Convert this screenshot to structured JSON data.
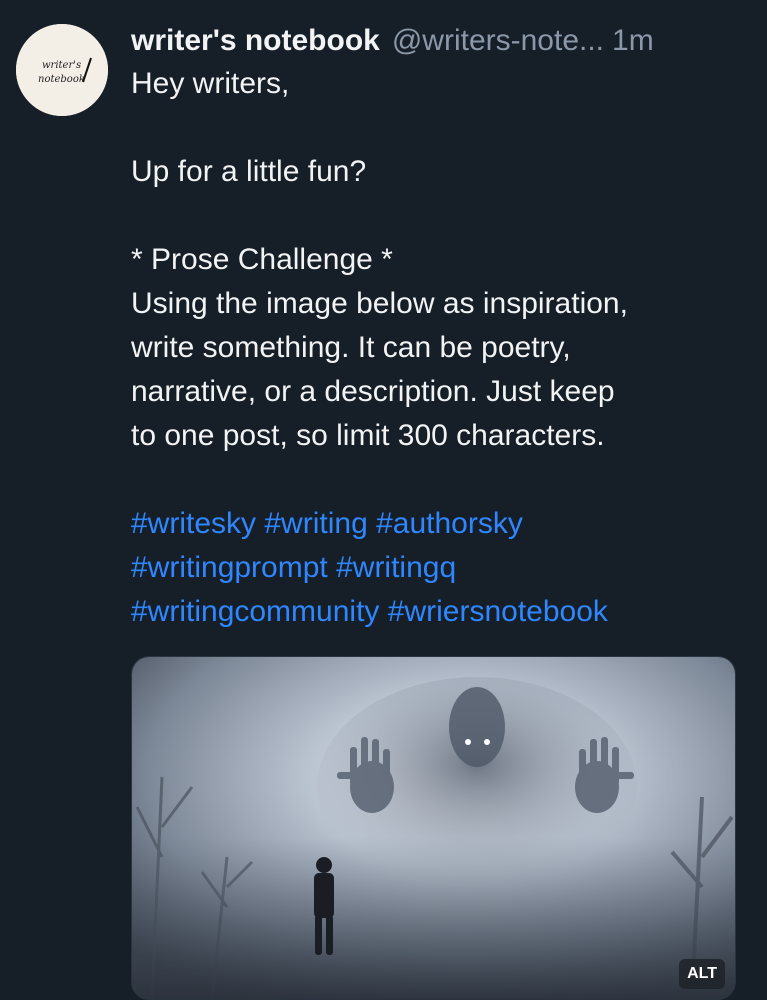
{
  "post": {
    "author": {
      "display_name": "writer's notebook",
      "handle": "@writers-note...",
      "avatar_text_line1": "writer's",
      "avatar_text_line2": "notebook"
    },
    "time": "1m",
    "body_lines": [
      "Hey writers,",
      "",
      "Up for a little fun?",
      "",
      "* Prose Challenge *",
      "Using the image below as inspiration,",
      "write something. It can be poetry,",
      "narrative, or a description. Just keep",
      "to one post, so limit 300 characters."
    ],
    "hashtags": [
      [
        "#writesky",
        "#writing",
        "#authorsky"
      ],
      [
        "#writingprompt",
        "#writingq"
      ],
      [
        "#writingcommunity",
        "#wriersnotebook"
      ]
    ],
    "image": {
      "alt_badge": "ALT"
    }
  },
  "colors": {
    "background": "#161e27",
    "text": "#f1f3f5",
    "muted": "#8b98a8",
    "link": "#2f87ff"
  }
}
